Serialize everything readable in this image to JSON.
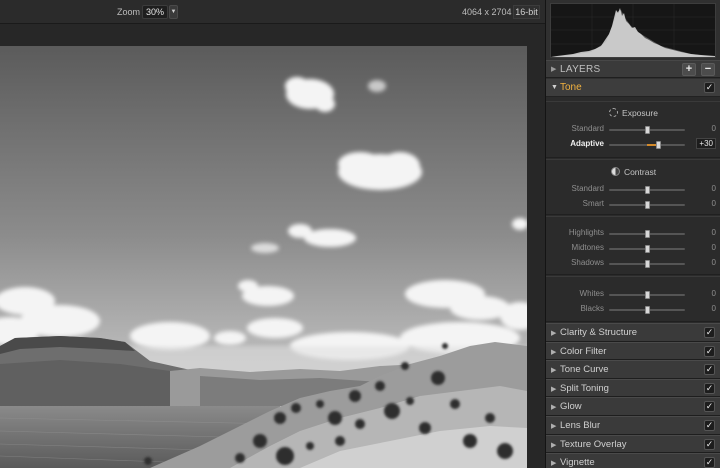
{
  "toolbar": {
    "zoom_label": "Zoom",
    "zoom_value": "30%",
    "zoom_dropdown_glyph": "▼",
    "dimensions": "4064 x 2704",
    "bit_depth": "16-bit"
  },
  "layers": {
    "title": "LAYERS",
    "add_label": "+",
    "remove_label": "−",
    "collapse_glyph": "▶"
  },
  "tone": {
    "title": "Tone",
    "expand_glyph": "▼",
    "enabled_glyph": "✓",
    "exposure": {
      "title": "Exposure",
      "icon": "exposure-sun-icon",
      "sliders": [
        {
          "label": "Standard",
          "value": "0",
          "level": 0
        },
        {
          "label": "Adaptive",
          "value": "+30",
          "level": 30
        }
      ]
    },
    "contrast": {
      "title": "Contrast",
      "icon": "contrast-half-circle-icon",
      "sliders": [
        {
          "label": "Standard",
          "value": "0",
          "level": 0
        },
        {
          "label": "Smart",
          "value": "0",
          "level": 0
        }
      ]
    },
    "tones": {
      "sliders": [
        {
          "label": "Highlights",
          "value": "0",
          "level": 0
        },
        {
          "label": "Midtones",
          "value": "0",
          "level": 0
        },
        {
          "label": "Shadows",
          "value": "0",
          "level": 0
        }
      ]
    },
    "levels": {
      "sliders": [
        {
          "label": "Whites",
          "value": "0",
          "level": 0
        },
        {
          "label": "Blacks",
          "value": "0",
          "level": 0
        }
      ]
    }
  },
  "sections": [
    {
      "title": "Clarity & Structure",
      "check": "✓"
    },
    {
      "title": "Color Filter",
      "check": "✓"
    },
    {
      "title": "Tone Curve",
      "check": "✓"
    },
    {
      "title": "Split Toning",
      "check": "✓"
    },
    {
      "title": "Glow",
      "check": "✓"
    },
    {
      "title": "Lens Blur",
      "check": "✓"
    },
    {
      "title": "Texture Overlay",
      "check": "✓"
    },
    {
      "title": "Vignette",
      "check": "✓"
    }
  ],
  "section_arrow_glyph": "▶",
  "colors": {
    "accent": "#f2b23f",
    "slider_fill": "#d48a2a",
    "panel_bg": "#303030"
  }
}
